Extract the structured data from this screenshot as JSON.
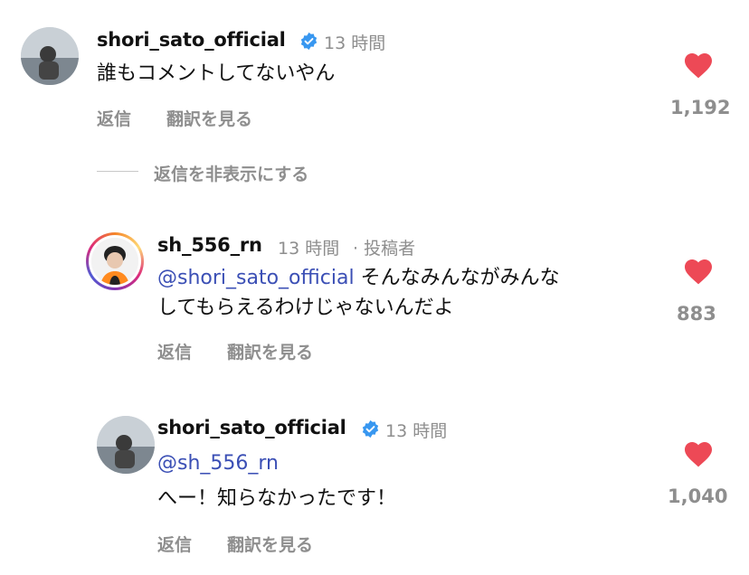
{
  "comments": [
    {
      "username": "shori_sato_official",
      "verified": true,
      "time": "13 時間",
      "text": "誰もコメントしてないやん",
      "reply_label": "返信",
      "translate_label": "翻訳を見る",
      "likes": "1,192"
    },
    {
      "username": "sh_556_rn",
      "time": "13 時間",
      "author_tag": "· 投稿者",
      "mention": "@shori_sato_official",
      "text_line1": "そんなみんながみんな",
      "text_line2": "してもらえるわけじゃないんだよ",
      "reply_label": "返信",
      "translate_label": "翻訳を見る",
      "likes": "883"
    },
    {
      "username": "shori_sato_official",
      "verified": true,
      "time": "13 時間",
      "mention": "@sh_556_rn",
      "text": "へー！知らなかったです！",
      "reply_label": "返信",
      "translate_label": "翻訳を見る",
      "likes": "1,040"
    }
  ],
  "hide_replies_label": "返信を非表示にする",
  "colors": {
    "heart": "#ed4956",
    "verified": "#3897f0",
    "mention": "#3b4fb5",
    "secondary_text": "#8e8e8e"
  }
}
